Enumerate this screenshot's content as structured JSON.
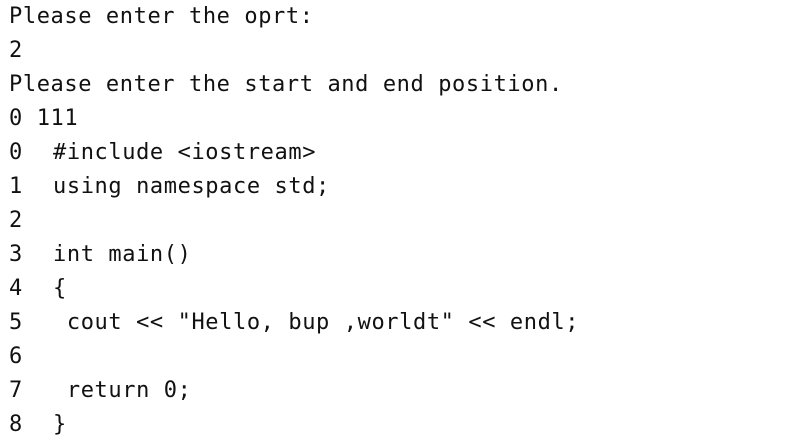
{
  "terminal": {
    "prompt_oprt": "Please enter the oprt:",
    "input_oprt": "2",
    "prompt_range": "Please enter the start and end position.",
    "input_range": "0 111",
    "code_lines": [
      {
        "num": "0",
        "text": "#include <iostream>"
      },
      {
        "num": "1",
        "text": "using namespace std;"
      },
      {
        "num": "2",
        "text": ""
      },
      {
        "num": "3",
        "text": "int main()"
      },
      {
        "num": "4",
        "text": "{"
      },
      {
        "num": "5",
        "text": " cout << \"Hello, bup ,worldt\" << endl;"
      },
      {
        "num": "6",
        "text": ""
      },
      {
        "num": "7",
        "text": " return 0;"
      },
      {
        "num": "8",
        "text": "}"
      }
    ]
  }
}
